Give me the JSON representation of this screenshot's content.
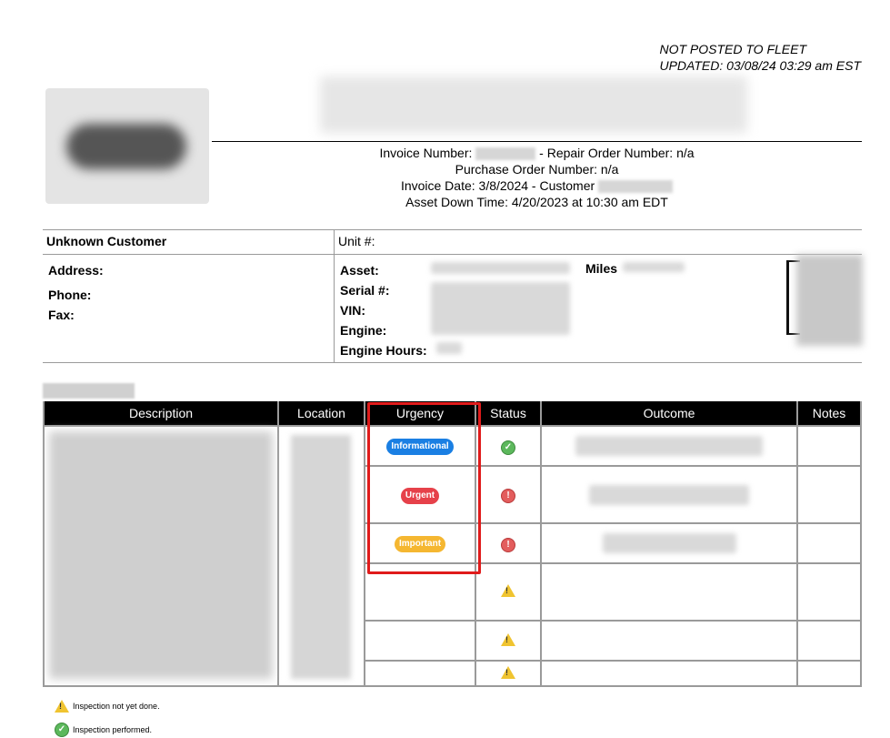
{
  "status": {
    "line1": "NOT POSTED TO FLEET",
    "line2": "UPDATED: 03/08/24 03:29 am EST"
  },
  "invoice": {
    "invoice_label": "Invoice Number:",
    "repair_order": "- Repair Order Number: n/a",
    "purchase_order": "Purchase Order Number: n/a",
    "invoice_date": "Invoice Date: 3/8/2024 - Customer",
    "asset_down": "Asset Down Time: 4/20/2023 at 10:30 am EDT"
  },
  "customer": {
    "name": "Unknown Customer",
    "unit_label": "Unit #:",
    "address_label": "Address:",
    "phone_label": "Phone:",
    "fax_label": "Fax:",
    "asset_label": "Asset:",
    "serial_label": "Serial #:",
    "vin_label": "VIN:",
    "engine_label": "Engine:",
    "engine_hours_label": "Engine Hours:",
    "miles_label": "Miles"
  },
  "items": {
    "headers": [
      "Description",
      "Location",
      "Urgency",
      "Status",
      "Outcome",
      "Notes"
    ],
    "rows": [
      {
        "urgency": "Informational",
        "status": "done"
      },
      {
        "urgency": "Urgent",
        "status": "failed"
      },
      {
        "urgency": "Important",
        "status": "failed"
      },
      {
        "urgency": "",
        "status": "pending"
      },
      {
        "urgency": "",
        "status": "pending"
      },
      {
        "urgency": "",
        "status": "pending"
      }
    ]
  },
  "legend": {
    "not_done": "Inspection not yet done.",
    "performed": "Inspection performed."
  },
  "colors": {
    "informational": "#1a7fe3",
    "urgent": "#e6414a",
    "important": "#f5b731",
    "highlight": "#e01b1b"
  }
}
